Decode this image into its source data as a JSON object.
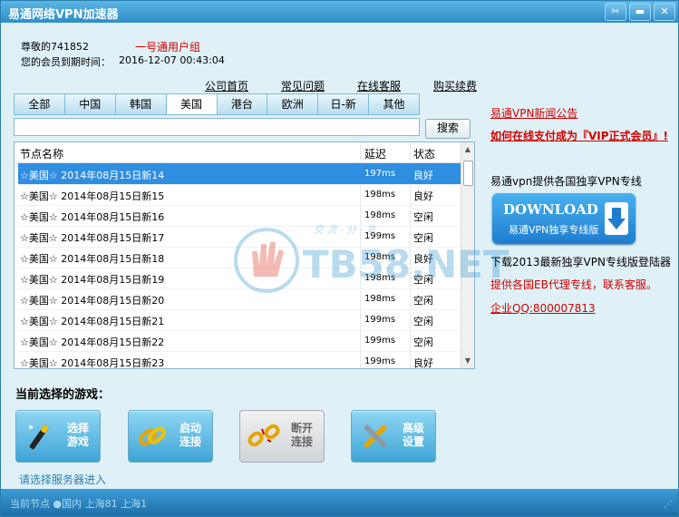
{
  "window": {
    "title": "易通网络VPN加速器"
  },
  "user": {
    "greeting": "尊敬的741852",
    "group": "一号通用户组",
    "expiry_label": "您的会员到期时间：",
    "expiry_value": "2016-12-07 00:43:04"
  },
  "nav_links": [
    "公司首页",
    "常见问题",
    "在线客服",
    "购买续费"
  ],
  "tabs": [
    "全部",
    "中国",
    "韩国",
    "美国",
    "港台",
    "欧洲",
    "日-新",
    "其他"
  ],
  "active_tab": "美国",
  "search": {
    "value": "",
    "button": "搜索"
  },
  "table": {
    "headers": [
      "节点名称",
      "延迟",
      "状态"
    ],
    "rows": [
      {
        "name": "☆美国☆ 2014年08月15日新14",
        "latency": "197ms",
        "status": "良好"
      },
      {
        "name": "☆美国☆ 2014年08月15日新15",
        "latency": "198ms",
        "status": "良好"
      },
      {
        "name": "☆美国☆ 2014年08月15日新16",
        "latency": "198ms",
        "status": "空闲"
      },
      {
        "name": "☆美国☆ 2014年08月15日新17",
        "latency": "199ms",
        "status": "空闲"
      },
      {
        "name": "☆美国☆ 2014年08月15日新18",
        "latency": "198ms",
        "status": "良好"
      },
      {
        "name": "☆美国☆ 2014年08月15日新19",
        "latency": "198ms",
        "status": "空闲"
      },
      {
        "name": "☆美国☆ 2014年08月15日新20",
        "latency": "198ms",
        "status": "空闲"
      },
      {
        "name": "☆美国☆ 2014年08月15日新21",
        "latency": "199ms",
        "status": "空闲"
      },
      {
        "name": "☆美国☆ 2014年08月15日新22",
        "latency": "199ms",
        "status": "空闲"
      },
      {
        "name": "☆美国☆ 2014年08月15日新23",
        "latency": "199ms",
        "status": "良好"
      }
    ],
    "selected_index": 0
  },
  "watermark": {
    "text": "TB58.NET",
    "sub": "交 流 · 分 · 享"
  },
  "right": {
    "news": "易通VPN新闻公告",
    "pay": "如何在线支付成为『VIP正式会员』!",
    "dedicated": "易通vpn提供各国独享VPN专线",
    "download_title": "DOWNLOAD",
    "download_sub": "易通VPN独享专线版",
    "download_note": "下载2013最新独享VPN专线版登陆器",
    "eb": "提供各国EB代理专线，联系客服。",
    "qq": "企业QQ:800007813"
  },
  "current_game_label": "当前选择的游戏：",
  "buttons": [
    {
      "line1": "选择",
      "line2": "游戏",
      "icon": "magic-wand-icon"
    },
    {
      "line1": "启动",
      "line2": "连接",
      "icon": "chain-link-icon"
    },
    {
      "line1": "断开",
      "line2": "连接",
      "icon": "broken-link-icon"
    },
    {
      "line1": "高级",
      "line2": "设置",
      "icon": "tools-icon"
    }
  ],
  "hint": "请选择服务器进入",
  "status": {
    "text": "当前节点  ●国内 上海81  上海1"
  },
  "colors": {
    "accent": "#2c8dc8",
    "selected_row": "#2f8ee0",
    "link_red": "#d00000"
  }
}
